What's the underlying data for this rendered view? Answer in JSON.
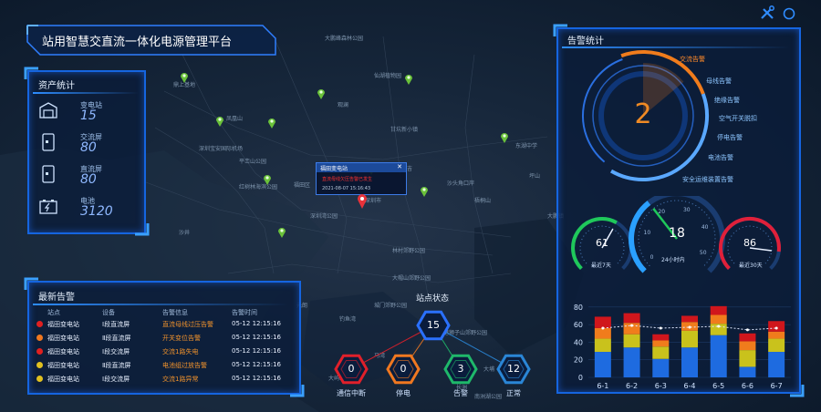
{
  "header": {
    "title": "站用智慧交直流一体化电源管理平台"
  },
  "toolbar": {
    "tools_icon": "wrench-screwdriver-icon",
    "power_icon": "power-icon"
  },
  "map": {
    "labels": [
      "大鹏峰森林公园",
      "鼎上基地",
      "凤凰山",
      "深圳宝安国际机场",
      "平峦山公园",
      "红树林海滨公园",
      "深圳湾公园",
      "沙井",
      "福田区",
      "深圳市",
      "甘坑新小镇",
      "沙头角口岸",
      "东湖中学",
      "坪山",
      "梧桐山",
      "布吉",
      "仙湖植物园",
      "观澜",
      "大鹏镇",
      "林村郊野公园",
      "大帽山郊野公园",
      "钓鱼湾",
      "元朗",
      "香港",
      "大屿山",
      "狮子山郊野公园",
      "城门郊野公园",
      "大埔",
      "南洲湖公园",
      "马湾",
      "长洲"
    ],
    "popup": {
      "title": "福田变电站",
      "alarm": "直流母线欠压告警已发生",
      "time": "2021-08-07 15:16:43"
    }
  },
  "assets": {
    "title": "资产统计",
    "items": [
      {
        "label": "变电站",
        "value": "15",
        "icon": "substation-icon"
      },
      {
        "label": "交流屏",
        "value": "80",
        "icon": "ac-panel-icon"
      },
      {
        "label": "直流屏",
        "value": "80",
        "icon": "dc-panel-icon"
      },
      {
        "label": "电池",
        "value": "3120",
        "icon": "battery-icon"
      }
    ]
  },
  "alarms": {
    "title": "最新告警",
    "headers": [
      "站点",
      "设备",
      "告警信息",
      "告警时间"
    ],
    "rows": [
      {
        "color": "#e02020",
        "site": "福田变电站",
        "device": "Ⅰ段直流屏",
        "info": "直流母线过压告警",
        "time": "05-12 12:15:16"
      },
      {
        "color": "#f07820",
        "site": "福田变电站",
        "device": "Ⅱ段直流屏",
        "info": "开关变位告警",
        "time": "05-12 12:15:16"
      },
      {
        "color": "#e02020",
        "site": "福田变电站",
        "device": "Ⅰ段交流屏",
        "info": "交流1路失电",
        "time": "05-12 12:15:16"
      },
      {
        "color": "#e0c020",
        "site": "福田变电站",
        "device": "Ⅱ段直流屏",
        "info": "电池组过放告警",
        "time": "05-12 12:15:16"
      },
      {
        "color": "#e0c020",
        "site": "福田变电站",
        "device": "Ⅰ段交流屏",
        "info": "交流1路异常",
        "time": "05-12 12:15:16"
      }
    ]
  },
  "station_status": {
    "title": "站点状态",
    "total": "15",
    "items": [
      {
        "label": "通信中断",
        "value": "0",
        "color": "#e0202a"
      },
      {
        "label": "停电",
        "value": "0",
        "color": "#f07820"
      },
      {
        "label": "告警",
        "value": "3",
        "color": "#1fb86a"
      },
      {
        "label": "正常",
        "value": "12",
        "color": "#2a86d6"
      }
    ]
  },
  "alarm_stats": {
    "title": "告警统计",
    "center_value": "2",
    "categories": [
      "交流告警",
      "母线告警",
      "绝缘告警",
      "空气开关脱扣",
      "停电告警",
      "电池告警",
      "安全运维装置告警"
    ],
    "gauges": [
      {
        "value": "61",
        "label": "最近7天",
        "fraction": 0.61
      },
      {
        "value": "18",
        "label": "24小时内",
        "fraction": 0.36,
        "ticks": [
          "0",
          "10",
          "20",
          "30",
          "40",
          "50"
        ]
      },
      {
        "value": "86",
        "label": "最近30天",
        "fraction": 0.86
      }
    ]
  },
  "chart_data": {
    "type": "bar",
    "categories": [
      "6-1",
      "6-2",
      "6-3",
      "6-4",
      "6-5",
      "6-6",
      "6-7"
    ],
    "yticks": [
      "0",
      "20",
      "40",
      "60",
      "80"
    ],
    "ylim": [
      0,
      85
    ],
    "stacked": true,
    "series": [
      {
        "color": "#1e6be0",
        "values": [
          29,
          34,
          21,
          34,
          48,
          12,
          29
        ]
      },
      {
        "color": "#c9c21c",
        "values": [
          15,
          15,
          14,
          19,
          13,
          19,
          15
        ]
      },
      {
        "color": "#f07c1c",
        "values": [
          12,
          13,
          7,
          10,
          10,
          10,
          8
        ]
      },
      {
        "color": "#d0161c",
        "values": [
          13,
          11,
          7,
          7,
          10,
          9,
          12
        ]
      }
    ],
    "trend": [
      56,
      59,
      56,
      57,
      58,
      54,
      56
    ]
  }
}
